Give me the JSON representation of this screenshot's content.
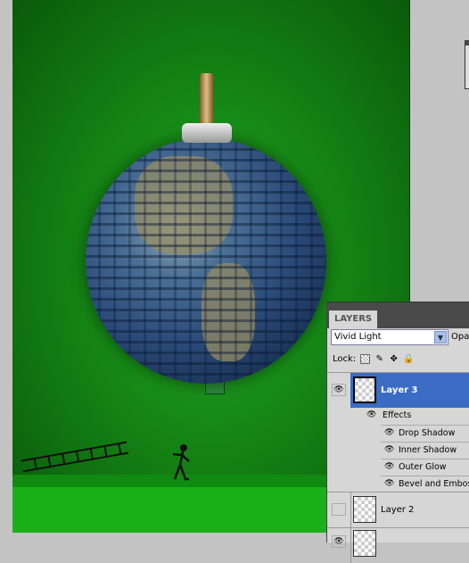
{
  "layers_panel": {
    "tab": "LAYERS",
    "blend_mode": "Vivid Light",
    "opacity_label": "Opac",
    "lock_label": "Lock:",
    "lock_icons": [
      "transparent-pixels-icon",
      "brush-icon",
      "move-icon",
      "lock-icon"
    ],
    "layers": [
      {
        "name": "Layer 3",
        "visible": true,
        "selected": true,
        "effects_label": "Effects",
        "effects": [
          "Drop Shadow",
          "Inner Shadow",
          "Outer Glow",
          "Bevel and Emboss"
        ]
      },
      {
        "name": "Layer 2",
        "visible": false,
        "selected": false
      },
      {
        "name": "",
        "visible": true,
        "selected": false
      }
    ]
  },
  "colors": {
    "selection": "#3a6cc4",
    "canvas_green": "#168a16"
  }
}
